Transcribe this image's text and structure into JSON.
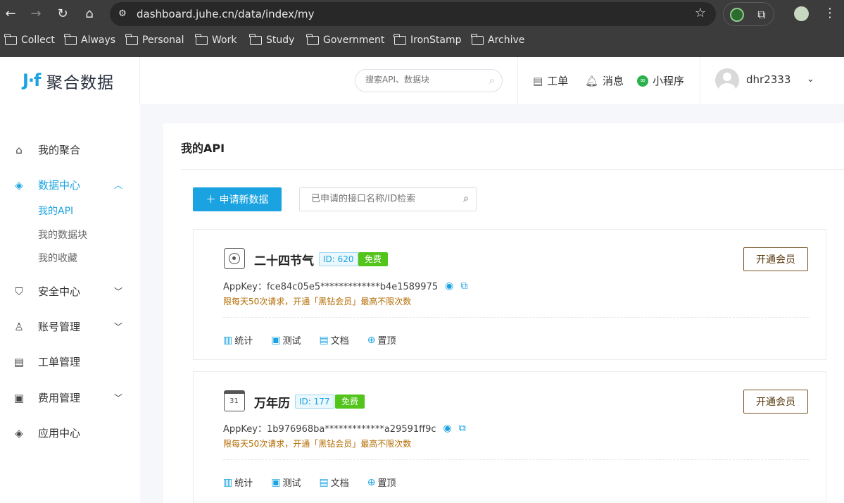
{
  "browser": {
    "url": "dashboard.juhe.cn/data/index/my",
    "bookmarks": [
      "Collect",
      "Always",
      "Personal",
      "Work",
      "Study",
      "Government",
      "IronStamp",
      "Archive"
    ]
  },
  "header": {
    "logo_mark": "J·f",
    "logo_text": "聚合数据",
    "search_placeholder": "搜索API、数据块",
    "ticket_label": "工单",
    "message_label": "消息",
    "miniprogram_label": "小程序",
    "username": "dhr2333"
  },
  "sidebar": {
    "items": [
      {
        "label": "我的聚合"
      },
      {
        "label": "数据中心"
      },
      {
        "label": "安全中心"
      },
      {
        "label": "账号管理"
      },
      {
        "label": "工单管理"
      },
      {
        "label": "费用管理"
      },
      {
        "label": "应用中心"
      }
    ],
    "sub_items": [
      {
        "label": "我的API"
      },
      {
        "label": "我的数据块"
      },
      {
        "label": "我的收藏"
      }
    ]
  },
  "main": {
    "title": "我的API",
    "add_button": "申请新数据",
    "filter_placeholder": "已申请的接口名称/ID检索",
    "cards": [
      {
        "name": "二十四节气",
        "id_badge": "ID: 620",
        "free_badge": "免费",
        "vip_button": "开通会员",
        "appkey": "AppKey：fce84c05e5*************b4e1589975",
        "limit": "限每天50次请求，开通「黑钻会员」最高不限次数",
        "icon_text": "",
        "actions": [
          "统计",
          "测试",
          "文档",
          "置顶"
        ]
      },
      {
        "name": "万年历",
        "id_badge": "ID: 177",
        "free_badge": "免费",
        "vip_button": "开通会员",
        "appkey": "AppKey：1b976968ba*************a29591ff9c",
        "limit": "限每天50次请求，开通「黑钻会员」最高不限次数",
        "icon_text": "31",
        "actions": [
          "统计",
          "测试",
          "文档",
          "置顶"
        ]
      }
    ]
  }
}
